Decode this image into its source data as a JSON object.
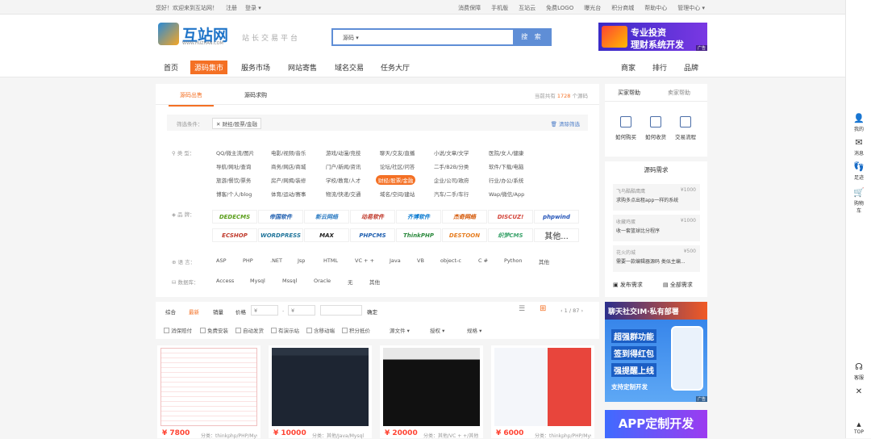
{
  "topbar": {
    "welcome": "您好！欢迎来到互站网！",
    "register": "注册",
    "login": "登录 ▾",
    "links": [
      "消费保障",
      "手机版",
      "互站云",
      "免费LOGO",
      "曝光台",
      "积分商城",
      "帮助中心",
      "管理中心 ▾"
    ]
  },
  "header": {
    "logo_name": "互站网",
    "logo_url": "WWW.HUZHAN.COM",
    "slogan": "站长交易平台",
    "search_scope": "源码 ▾",
    "search_button": "搜 索",
    "ad_line1": "专业投资",
    "ad_line2": "理财系统开发",
    "ad_tag": "广告"
  },
  "nav": {
    "left": [
      "首页",
      "源码集市",
      "服务市场",
      "网站寄售",
      "域名交易",
      "任务大厅"
    ],
    "right": [
      "商家",
      "排行",
      "品牌"
    ]
  },
  "main": {
    "tabs": [
      "源码出售",
      "源码求购"
    ],
    "count_prefix": "当前共有",
    "count": "1728",
    "count_suffix": "个源码",
    "filter_label": "筛选条件：",
    "filter_chip": "✕ 财经/股票/金融",
    "clear_filter": "清除筛选",
    "type_label": "类    型：",
    "types": [
      [
        "QQ/微主流/图片",
        "电影/视频/音乐",
        "游戏/动漫/竞技",
        "聊天/交友/直播",
        "小说/文章/文学",
        "医院/女人/健康"
      ],
      [
        "导航/网址/查询",
        "商务/网店/商城",
        "门户/新闻/资讯",
        "论坛/社区/问答",
        "二手/B2B/分类",
        "软件/下载/电脑"
      ],
      [
        "旅游/餐饮/票务",
        "房产/网揭/装修",
        "学校/教育/人才",
        "财经/股票/金融",
        "企业/公司/政府",
        "行业/办公/系统"
      ],
      [
        "博客/个人/blog",
        "体育/运动/赛事",
        "物流/快递/交通",
        "域名/空间/建站",
        "汽车/二手/车行",
        "Wap/微信/App"
      ]
    ],
    "brand_label": "品    牌：",
    "brands": [
      [
        "DEDECMS",
        "帝国软件",
        "新云网络",
        "动易软件",
        "齐博软件",
        "杰奇网络",
        "DISCUZ!",
        "phpwind"
      ],
      [
        "ECSHOP",
        "WORDPRESS",
        "MAX",
        "PHPCMS",
        "ThinkPHP",
        "DESTOON",
        "织梦CMS",
        "其他..."
      ]
    ],
    "lang_label": "语    言：",
    "langs": [
      "ASP",
      "PHP",
      ".NET",
      "Jsp",
      "HTML",
      "VC + +",
      "Java",
      "VB",
      "object-c",
      "C #",
      "Python",
      "其他"
    ],
    "db_label": "数据库：",
    "dbs": [
      "Access",
      "Mysql",
      "Mssql",
      "Oracle",
      "无",
      "其他"
    ]
  },
  "sortbar": {
    "sorts": [
      "综合",
      "最新",
      "销量",
      "价格"
    ],
    "price_from": "¥",
    "price_dash": "-",
    "price_to": "¥",
    "confirm": "确定",
    "page": "1 / 87",
    "checks": [
      "消保赔付",
      "免费安装",
      "自动发货",
      "有演示站",
      "含移动端",
      "积分抵价"
    ],
    "dropdowns": [
      "源文件 ▾",
      "授权 ▾",
      "规格 ▾"
    ]
  },
  "cards": [
    {
      "price": "¥ 7800",
      "desc": "分类：thinkphp/PHP/Mysql"
    },
    {
      "price": "¥ 10000",
      "desc": "分类：其他/Java/Mysql"
    },
    {
      "price": "¥ 20000",
      "desc": "分类：其他/VC + +/其他"
    },
    {
      "price": "¥ 6000",
      "desc": "分类：thinkphp/PHP/Mysql"
    }
  ],
  "side": {
    "help_tabs": [
      "买家帮助",
      "卖家帮助"
    ],
    "help_items": [
      "如何购买",
      "如何收货",
      "交易流程"
    ],
    "demand_title": "源码需求",
    "demands": [
      {
        "user": "飞鸟酷酷鹰鹰",
        "price": "¥1000",
        "text": "求购多点出租app一样的系统"
      },
      {
        "user": "收藏鸡蛋",
        "price": "¥1000",
        "text": "收一套篮球比分程序"
      },
      {
        "user": "花火的城",
        "price": "¥500",
        "text": "需要一款编辑器源码 类似主编..."
      }
    ],
    "publish": "发布需求",
    "all": "全部需求",
    "ad2_title": "聊天社交IM·私有部署",
    "ad2_lines": [
      "超强群功能",
      "签到得红包",
      "强提醒上线",
      "支持定制开发"
    ],
    "ad2_tag": "广告",
    "ad3": "APP定制开发"
  },
  "rightbar": [
    {
      "icon": "user-icon",
      "label": "我的"
    },
    {
      "icon": "message-icon",
      "label": "消息"
    },
    {
      "icon": "footprint-icon",
      "label": "足迹"
    },
    {
      "icon": "cart-icon",
      "label": "购物车"
    },
    {
      "icon": "service-icon",
      "label": "客服"
    },
    {
      "icon": "close-icon",
      "label": "✕"
    },
    {
      "icon": "top-icon",
      "label": "TOP"
    }
  ],
  "colors": {
    "accent": "#f47024",
    "blue": "#5f8ed6"
  }
}
